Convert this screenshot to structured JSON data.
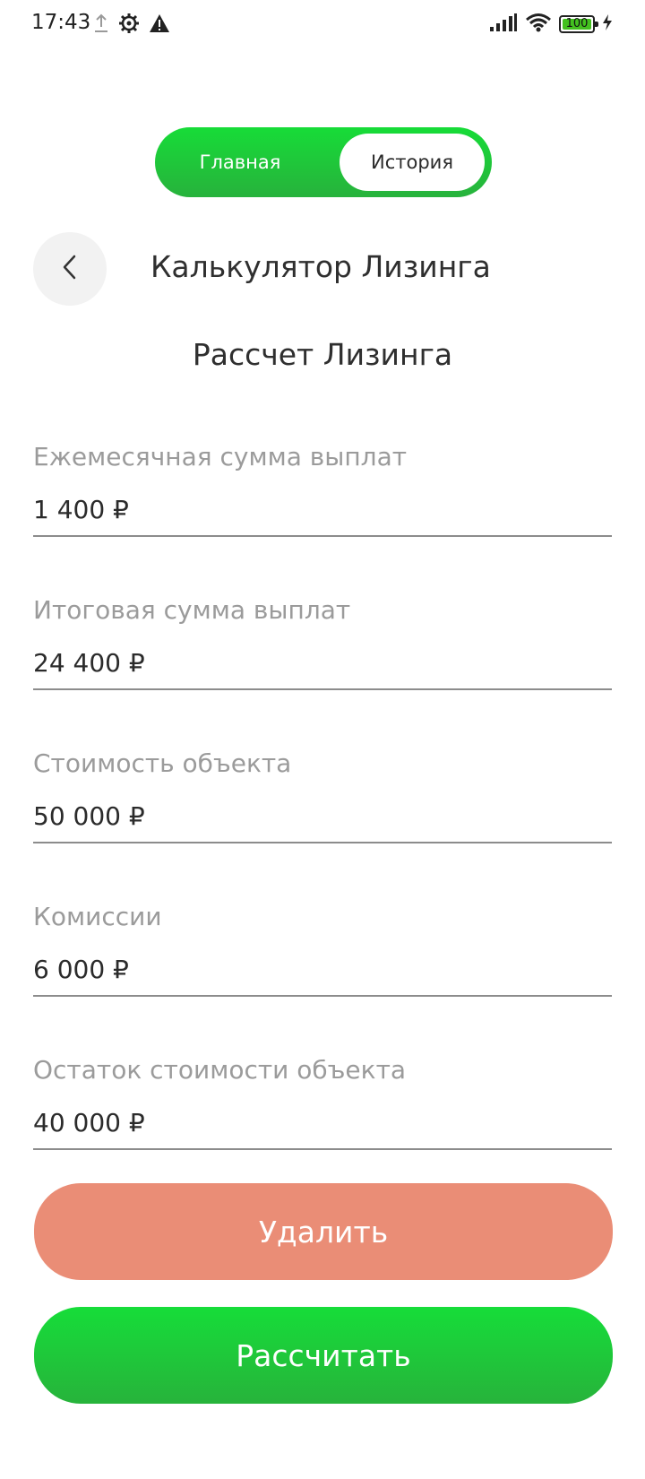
{
  "status_bar": {
    "time": "17:43",
    "battery_level": "100",
    "icons": [
      "upload-icon",
      "settings-gear-icon",
      "warning-icon",
      "signal-icon",
      "wifi-icon",
      "battery-icon",
      "charging-icon"
    ]
  },
  "nav": {
    "tabs": [
      {
        "label": "Главная",
        "selected": false
      },
      {
        "label": "История",
        "selected": true
      }
    ]
  },
  "header": {
    "back_icon": "chevron-left-icon",
    "title": "Калькулятор Лизинга"
  },
  "section_title": "Рассчет Лизинга",
  "fields": [
    {
      "label": "Ежемесячная сумма выплат",
      "value": "1 400 ₽"
    },
    {
      "label": "Итоговая сумма выплат",
      "value": "24 400 ₽"
    },
    {
      "label": "Стоимость объекта",
      "value": "50 000 ₽"
    },
    {
      "label": "Комиссии",
      "value": "6 000 ₽"
    },
    {
      "label": "Остаток стоимости объекта",
      "value": "40 000 ₽"
    }
  ],
  "actions": {
    "delete_label": "Удалить",
    "calculate_label": "Рассчитать"
  },
  "colors": {
    "accent_green": "#1ed43a",
    "delete_salmon": "#ea8d76",
    "label_gray": "#9b9b9b"
  }
}
